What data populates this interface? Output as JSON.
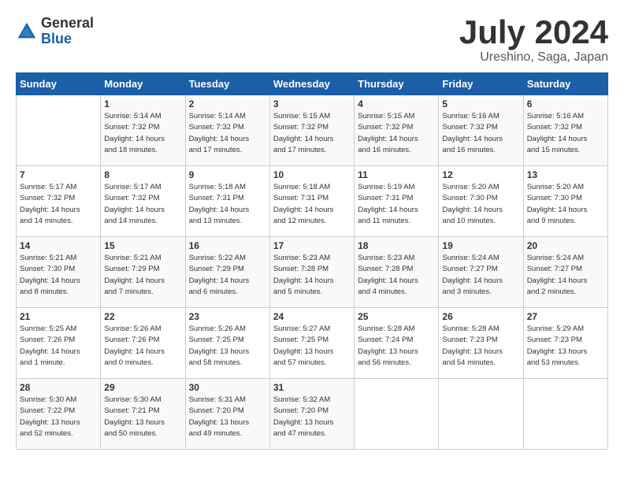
{
  "logo": {
    "general": "General",
    "blue": "Blue"
  },
  "title": "July 2024",
  "subtitle": "Ureshino, Saga, Japan",
  "headers": [
    "Sunday",
    "Monday",
    "Tuesday",
    "Wednesday",
    "Thursday",
    "Friday",
    "Saturday"
  ],
  "weeks": [
    [
      {
        "day": "",
        "info": ""
      },
      {
        "day": "1",
        "info": "Sunrise: 5:14 AM\nSunset: 7:32 PM\nDaylight: 14 hours\nand 18 minutes."
      },
      {
        "day": "2",
        "info": "Sunrise: 5:14 AM\nSunset: 7:32 PM\nDaylight: 14 hours\nand 17 minutes."
      },
      {
        "day": "3",
        "info": "Sunrise: 5:15 AM\nSunset: 7:32 PM\nDaylight: 14 hours\nand 17 minutes."
      },
      {
        "day": "4",
        "info": "Sunrise: 5:15 AM\nSunset: 7:32 PM\nDaylight: 14 hours\nand 16 minutes."
      },
      {
        "day": "5",
        "info": "Sunrise: 5:16 AM\nSunset: 7:32 PM\nDaylight: 14 hours\nand 16 minutes."
      },
      {
        "day": "6",
        "info": "Sunrise: 5:16 AM\nSunset: 7:32 PM\nDaylight: 14 hours\nand 15 minutes."
      }
    ],
    [
      {
        "day": "7",
        "info": "Sunrise: 5:17 AM\nSunset: 7:32 PM\nDaylight: 14 hours\nand 14 minutes."
      },
      {
        "day": "8",
        "info": "Sunrise: 5:17 AM\nSunset: 7:32 PM\nDaylight: 14 hours\nand 14 minutes."
      },
      {
        "day": "9",
        "info": "Sunrise: 5:18 AM\nSunset: 7:31 PM\nDaylight: 14 hours\nand 13 minutes."
      },
      {
        "day": "10",
        "info": "Sunrise: 5:18 AM\nSunset: 7:31 PM\nDaylight: 14 hours\nand 12 minutes."
      },
      {
        "day": "11",
        "info": "Sunrise: 5:19 AM\nSunset: 7:31 PM\nDaylight: 14 hours\nand 11 minutes."
      },
      {
        "day": "12",
        "info": "Sunrise: 5:20 AM\nSunset: 7:30 PM\nDaylight: 14 hours\nand 10 minutes."
      },
      {
        "day": "13",
        "info": "Sunrise: 5:20 AM\nSunset: 7:30 PM\nDaylight: 14 hours\nand 9 minutes."
      }
    ],
    [
      {
        "day": "14",
        "info": "Sunrise: 5:21 AM\nSunset: 7:30 PM\nDaylight: 14 hours\nand 8 minutes."
      },
      {
        "day": "15",
        "info": "Sunrise: 5:21 AM\nSunset: 7:29 PM\nDaylight: 14 hours\nand 7 minutes."
      },
      {
        "day": "16",
        "info": "Sunrise: 5:22 AM\nSunset: 7:29 PM\nDaylight: 14 hours\nand 6 minutes."
      },
      {
        "day": "17",
        "info": "Sunrise: 5:23 AM\nSunset: 7:28 PM\nDaylight: 14 hours\nand 5 minutes."
      },
      {
        "day": "18",
        "info": "Sunrise: 5:23 AM\nSunset: 7:28 PM\nDaylight: 14 hours\nand 4 minutes."
      },
      {
        "day": "19",
        "info": "Sunrise: 5:24 AM\nSunset: 7:27 PM\nDaylight: 14 hours\nand 3 minutes."
      },
      {
        "day": "20",
        "info": "Sunrise: 5:24 AM\nSunset: 7:27 PM\nDaylight: 14 hours\nand 2 minutes."
      }
    ],
    [
      {
        "day": "21",
        "info": "Sunrise: 5:25 AM\nSunset: 7:26 PM\nDaylight: 14 hours\nand 1 minute."
      },
      {
        "day": "22",
        "info": "Sunrise: 5:26 AM\nSunset: 7:26 PM\nDaylight: 14 hours\nand 0 minutes."
      },
      {
        "day": "23",
        "info": "Sunrise: 5:26 AM\nSunset: 7:25 PM\nDaylight: 13 hours\nand 58 minutes."
      },
      {
        "day": "24",
        "info": "Sunrise: 5:27 AM\nSunset: 7:25 PM\nDaylight: 13 hours\nand 57 minutes."
      },
      {
        "day": "25",
        "info": "Sunrise: 5:28 AM\nSunset: 7:24 PM\nDaylight: 13 hours\nand 56 minutes."
      },
      {
        "day": "26",
        "info": "Sunrise: 5:28 AM\nSunset: 7:23 PM\nDaylight: 13 hours\nand 54 minutes."
      },
      {
        "day": "27",
        "info": "Sunrise: 5:29 AM\nSunset: 7:23 PM\nDaylight: 13 hours\nand 53 minutes."
      }
    ],
    [
      {
        "day": "28",
        "info": "Sunrise: 5:30 AM\nSunset: 7:22 PM\nDaylight: 13 hours\nand 52 minutes."
      },
      {
        "day": "29",
        "info": "Sunrise: 5:30 AM\nSunset: 7:21 PM\nDaylight: 13 hours\nand 50 minutes."
      },
      {
        "day": "30",
        "info": "Sunrise: 5:31 AM\nSunset: 7:20 PM\nDaylight: 13 hours\nand 49 minutes."
      },
      {
        "day": "31",
        "info": "Sunrise: 5:32 AM\nSunset: 7:20 PM\nDaylight: 13 hours\nand 47 minutes."
      },
      {
        "day": "",
        "info": ""
      },
      {
        "day": "",
        "info": ""
      },
      {
        "day": "",
        "info": ""
      }
    ]
  ]
}
